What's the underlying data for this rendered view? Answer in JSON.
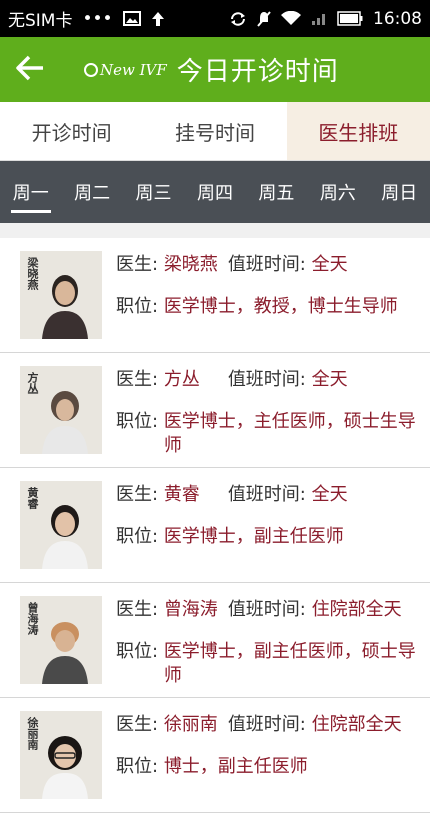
{
  "status_bar": {
    "carrier": "无SIM卡",
    "dots": "•••",
    "time": "16:08",
    "battery": "100"
  },
  "header": {
    "title": "今日开诊时间",
    "logo_text": "New IVF"
  },
  "top_tabs": [
    {
      "label": "开诊时间",
      "active": false
    },
    {
      "label": "挂号时间",
      "active": false
    },
    {
      "label": "医生排班",
      "active": true
    }
  ],
  "day_tabs": [
    "周一",
    "周二",
    "周三",
    "周四",
    "周五",
    "周六",
    "周日"
  ],
  "labels": {
    "doctor": "医生:",
    "duty_time": "值班时间:",
    "position": "职位:"
  },
  "doctors": [
    {
      "photo_name": "梁晓燕",
      "name": "梁晓燕",
      "duty": "全天",
      "position": "医学博士，教授，博士生导师"
    },
    {
      "photo_name": "方丛",
      "name": "方丛",
      "duty": "全天",
      "position": "医学博士，主任医师，硕士生导师"
    },
    {
      "photo_name": "黄睿",
      "name": "黄睿",
      "duty": "全天",
      "position": "医学博士，副主任医师"
    },
    {
      "photo_name": "曾海涛",
      "name": "曾海涛",
      "duty": "住院部全天",
      "position": "医学博士，副主任医师，硕士导师"
    },
    {
      "photo_name": "徐丽南",
      "name": "徐丽南",
      "duty": "住院部全天",
      "position": "博士，副主任医师"
    }
  ],
  "colors": {
    "header_green": "#5fae1c",
    "day_bar": "#4a4f55",
    "accent_red": "#8b1d2c",
    "active_tab_bg": "#f6eee3"
  }
}
